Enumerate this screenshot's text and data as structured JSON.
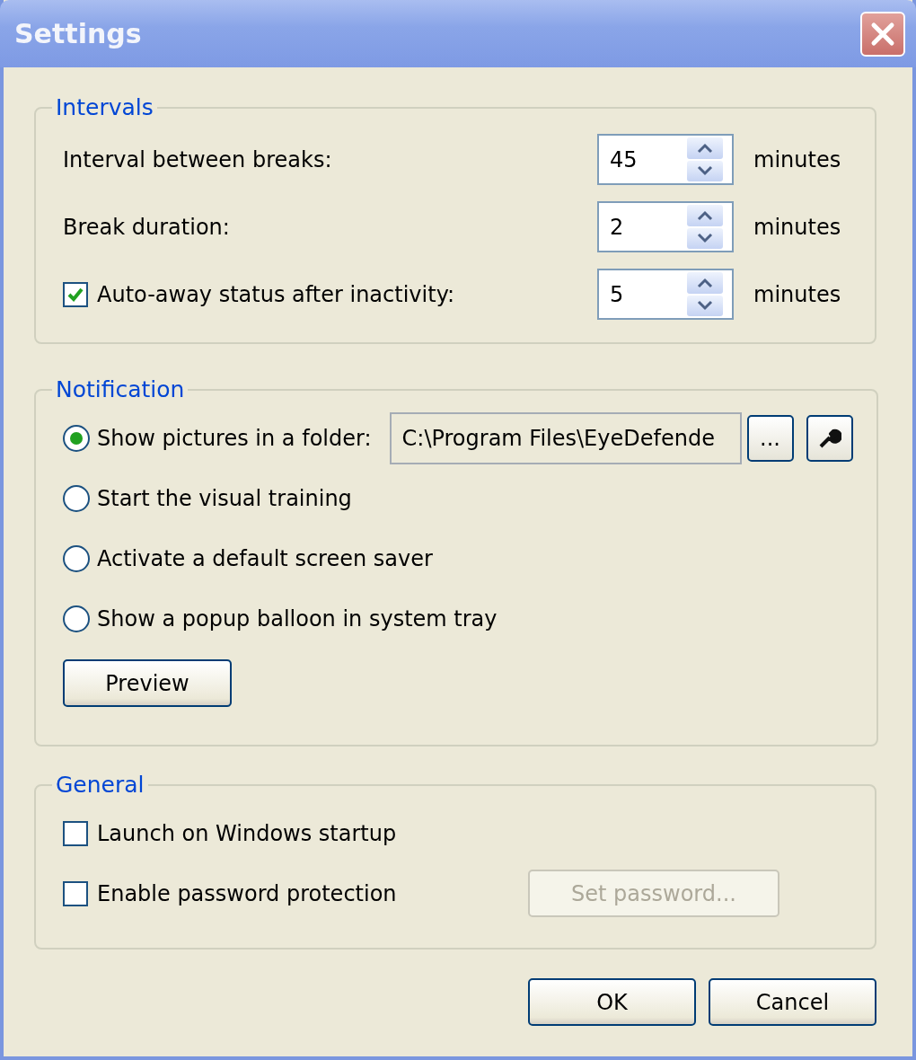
{
  "window": {
    "title": "Settings"
  },
  "intervals": {
    "title": "Intervals",
    "rows": [
      {
        "kind": "label",
        "label": "Interval between breaks:",
        "value": "45",
        "unit": "minutes"
      },
      {
        "kind": "label",
        "label": "Break duration:",
        "value": "2",
        "unit": "minutes"
      },
      {
        "kind": "checkbox",
        "checked": true,
        "label": "Auto-away status after inactivity:",
        "value": "5",
        "unit": "minutes"
      }
    ]
  },
  "notification": {
    "title": "Notification",
    "options": [
      {
        "label": "Show pictures in a folder:",
        "selected": true,
        "path": "C:\\Program Files\\EyeDefende",
        "browse": "..."
      },
      {
        "label": "Start the visual training",
        "selected": false
      },
      {
        "label": "Activate a default screen saver",
        "selected": false
      },
      {
        "label": "Show a popup balloon in system tray",
        "selected": false
      }
    ],
    "preview": "Preview"
  },
  "general": {
    "title": "General",
    "options": [
      {
        "label": "Launch on Windows startup",
        "checked": false
      },
      {
        "label": "Enable password protection",
        "checked": false,
        "button": {
          "label": "Set password...",
          "disabled": true
        }
      }
    ]
  },
  "buttons": [
    {
      "label": "OK"
    },
    {
      "label": "Cancel"
    }
  ]
}
